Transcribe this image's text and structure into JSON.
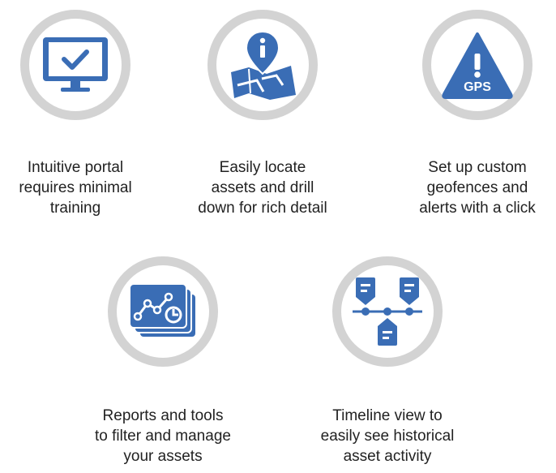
{
  "colors": {
    "icon_blue": "#3a6db5",
    "ring_gray": "#d3d3d3",
    "text": "#222222"
  },
  "features": [
    {
      "icon": "monitor-checkmark-icon",
      "lines": [
        "Intuitive portal",
        "requires minimal",
        "training"
      ]
    },
    {
      "icon": "map-location-pin-icon",
      "lines": [
        "Easily locate",
        "assets and drill",
        "down for rich detail"
      ]
    },
    {
      "icon": "gps-warning-triangle-icon",
      "badge": "GPS",
      "lines": [
        "Set up custom",
        "geofences and",
        "alerts with a click"
      ]
    },
    {
      "icon": "reports-chart-icon",
      "lines": [
        "Reports and tools",
        "to filter and manage",
        "your assets"
      ]
    },
    {
      "icon": "timeline-icon",
      "lines": [
        "Timeline view to",
        "easily see historical",
        "asset activity"
      ]
    }
  ]
}
